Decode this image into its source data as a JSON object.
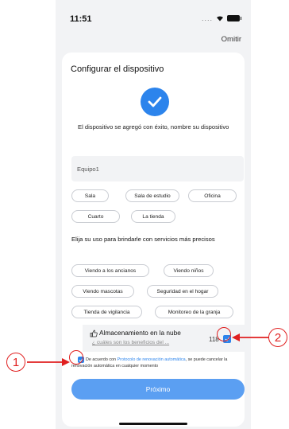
{
  "status_bar": {
    "time": "11:51",
    "signal": "....",
    "wifi": "▲"
  },
  "header": {
    "skip_label": "Omitir"
  },
  "card": {
    "title": "Configurar el dispositivo",
    "success_message": "El dispositivo se agregó con éxito, nombre su dispositivo",
    "name_input_value": "Equipo1",
    "rooms": [
      "Sala",
      "Sala de estudio",
      "Oficina",
      "Cuarto",
      "La tienda"
    ],
    "usage_title": "Elija su uso para brindarle con servicios más precisos",
    "usages": [
      "Viendo a los ancianos",
      "Viendo niños",
      "Viendo mascotas",
      "Seguridad en el hogar",
      "Tienda de vigilancia",
      "Monitoreo de la granja"
    ]
  },
  "cloud": {
    "title": "Almacenamiento en la nube",
    "link": "¿ cuáles son los beneficios del ...",
    "price": "118",
    "checked": true
  },
  "agreement": {
    "prefix": "De acuerdo con",
    "link": "Protocolo de renovación automática",
    "suffix": ", se puede cancelar la renovación automática en cualquier momento",
    "checked": true
  },
  "next_button": "Próximo",
  "annotations": {
    "one": "1",
    "two": "2"
  },
  "colors": {
    "accent": "#2c84ec",
    "button": "#5b9ff2",
    "annotation": "#e02020"
  }
}
